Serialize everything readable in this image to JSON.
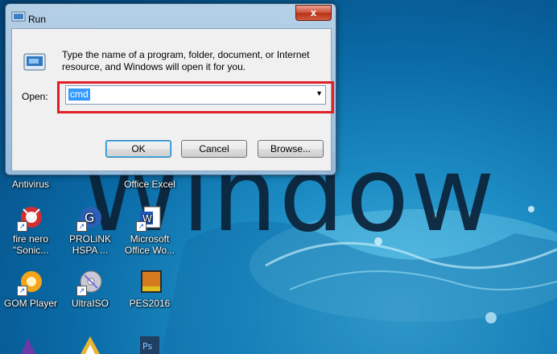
{
  "desktop": {
    "wallpaper_text": "Window",
    "icons": [
      {
        "label": "Antivirus",
        "icon": "antivirus-icon"
      },
      {
        "label": "Office Excel",
        "icon": "excel-icon"
      },
      {
        "label": "fire nero ''Sonic...",
        "icon": "nero-icon"
      },
      {
        "label": "PROLiNK HSPA ...",
        "icon": "prolink-icon"
      },
      {
        "label": "Microsoft Office Wo...",
        "icon": "word-icon"
      },
      {
        "label": "GOM Player",
        "icon": "gom-player-icon"
      },
      {
        "label": "UltraISO",
        "icon": "ultraiso-icon"
      },
      {
        "label": "PES2016",
        "icon": "pes2016-icon"
      }
    ]
  },
  "dialog": {
    "title": "Run",
    "close_label": "x",
    "instructions": "Type the name of a program, folder, document, or Internet resource, and Windows will open it for you.",
    "open_label": "Open:",
    "open_value": "cmd",
    "buttons": {
      "ok": "OK",
      "cancel": "Cancel",
      "browse": "Browse..."
    }
  },
  "colors": {
    "highlight_border": "#e21f26",
    "selection": "#3399ff"
  }
}
